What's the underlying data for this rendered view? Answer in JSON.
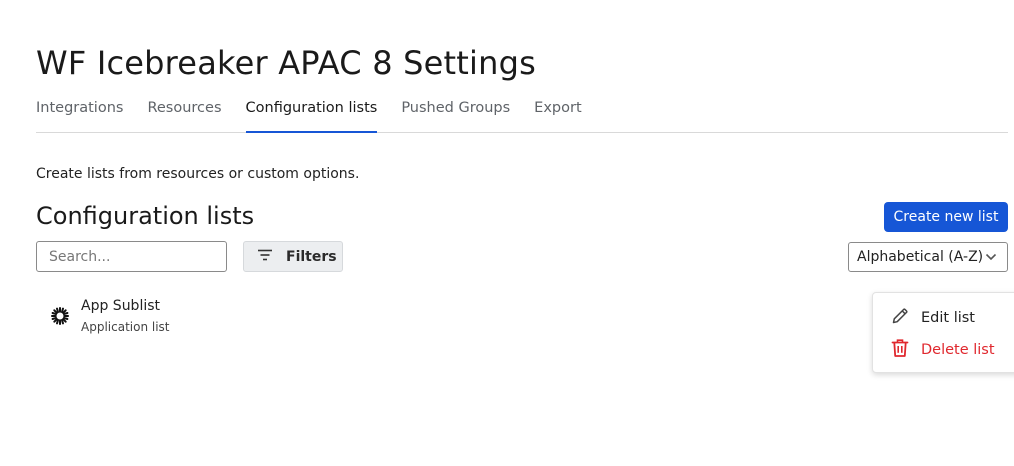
{
  "page": {
    "title": "WF Icebreaker APAC 8 Settings"
  },
  "tabs": [
    {
      "label": "Integrations"
    },
    {
      "label": "Resources"
    },
    {
      "label": "Configuration lists",
      "active": true
    },
    {
      "label": "Pushed Groups"
    },
    {
      "label": "Export"
    }
  ],
  "content": {
    "intro": "Create lists from resources or custom options.",
    "section_title": "Configuration lists",
    "create_button": "Create new list",
    "search_placeholder": "Search...",
    "filters_label": "Filters",
    "sort": {
      "selected": "Alphabetical (A-Z)"
    }
  },
  "lists": [
    {
      "name": "App Sublist",
      "type": "Application list",
      "icon": "app-gear-icon"
    }
  ],
  "context_menu": {
    "items": [
      {
        "label": "Edit list",
        "icon": "pencil-icon"
      },
      {
        "label": "Delete list",
        "icon": "trash-icon",
        "color": "#e0282e"
      }
    ]
  },
  "colors": {
    "accent": "#1656d6",
    "danger": "#e0282e"
  }
}
